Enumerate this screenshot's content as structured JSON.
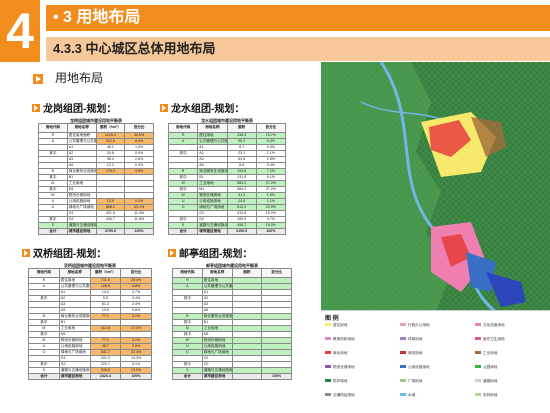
{
  "header": {
    "chapter_number": "4",
    "chapter_title": "• 3 用地布局",
    "section_title": "4.3.3 中心城区总体用地布局"
  },
  "subsection": {
    "title": "用地布局"
  },
  "groups": [
    {
      "key": "longgang",
      "title": "龙岗组团-规划：",
      "table_title": "龙岗组团城市建设用地平衡表",
      "headers": [
        "用地代码",
        "用地名称",
        "面积（hm²）",
        "百分比"
      ],
      "rows": [
        [
          "R",
          "居住用地面积",
          "1215.4",
          "30.5%",
          "hl"
        ],
        [
          "A",
          "公共管理与公共服务设施用地",
          "312.6",
          "8.4%",
          "hl"
        ],
        [
          "",
          "A1",
          "46.1",
          "1.0%",
          ""
        ],
        [
          "其中",
          "A2",
          "34.8",
          "0.9%",
          ""
        ],
        [
          "",
          "A3",
          "96.4",
          "2.6%",
          ""
        ],
        [
          "",
          "A5",
          "12.2",
          "0.4%",
          ""
        ],
        [
          "B",
          "商业服务业设施用地",
          "176.0",
          "4.8%",
          "hl"
        ],
        [
          "其中",
          "B1",
          "",
          "",
          ""
        ],
        [
          "M",
          "工业用地",
          "",
          "",
          ""
        ],
        [
          "其中",
          "M1",
          "",
          "",
          ""
        ],
        [
          "W",
          "物流仓储用地",
          "",
          "",
          ""
        ],
        [
          "U",
          "公用设施用地",
          "13.9",
          "0.4%",
          "hl"
        ],
        [
          "G",
          "绿地与广场用地",
          "858.2",
          "23.1%",
          "hl"
        ],
        [
          "",
          "G1",
          "421.5",
          "11.3%",
          ""
        ],
        [
          "其中",
          "G2",
          "436.7",
          "11.8%",
          ""
        ],
        [
          "S",
          "道路与交通设施用地",
          "",
          "",
          "g"
        ],
        [
          "合计",
          "城市建设用地",
          "3705.0",
          "100%",
          "t"
        ]
      ]
    },
    {
      "key": "longshui",
      "title": "龙水组团-规划：",
      "table_title": "龙水组团城市建设用地平衡表",
      "headers": [
        "用地代码",
        "用地名称",
        "面积",
        "百分比"
      ],
      "rows": [
        [
          "R",
          "居住用地",
          "338.4",
          "15.7%",
          "g"
        ],
        [
          "A",
          "公共管理与公共服务设施用地",
          "95.2",
          "4.4%",
          "g"
        ],
        [
          "",
          "A1",
          "8.7",
          "0.4%",
          ""
        ],
        [
          "其中",
          "A2",
          "23.1",
          "1.1%",
          ""
        ],
        [
          "",
          "A3",
          "54.6",
          "2.5%",
          ""
        ],
        [
          "",
          "A5",
          "8.8",
          "0.4%",
          ""
        ],
        [
          "B",
          "商业服务业设施用地",
          "154.8",
          "7.2%",
          "g"
        ],
        [
          "其中",
          "B1",
          "131.5",
          "6.1%",
          ""
        ],
        [
          "M",
          "工业用地",
          "584.2",
          "27.2%",
          "g"
        ],
        [
          "其中",
          "M1",
          "584.2",
          "27.2%",
          ""
        ],
        [
          "W",
          "物流仓储用地",
          "31.3",
          "1.5%",
          "g"
        ],
        [
          "U",
          "公用设施用地",
          "24.6",
          "1.1%",
          "g"
        ],
        [
          "G",
          "绿地与广场用地",
          "513.3",
          "23.9%",
          "g"
        ],
        [
          "",
          "G1",
          "412.8",
          "19.2%",
          ""
        ],
        [
          "其中",
          "G2",
          "100.5",
          "4.7%",
          ""
        ],
        [
          "S",
          "道路与交通设施用地",
          "408.7",
          "19.0%",
          "g"
        ],
        [
          "合计",
          "城市建设用地",
          "2150.5",
          "100%",
          "t"
        ]
      ]
    },
    {
      "key": "shuangqiao",
      "title": "双桥组团-规划：",
      "table_title": "双桥组团城市建设用地平衡表",
      "headers": [
        "用地代码",
        "用地名称",
        "面积（hm²）",
        "百分比"
      ],
      "rows": [
        [
          "R",
          "居住用地",
          "711.5",
          "29.4%",
          "hl"
        ],
        [
          "A",
          "公共管理与公共服务设施用地",
          "128.6",
          "4.8%",
          "hl"
        ],
        [
          "",
          "A1",
          "14.2",
          "0.7%",
          ""
        ],
        [
          "其中",
          "A2",
          "9.5",
          "0.4%",
          ""
        ],
        [
          "",
          "A3",
          "61.2",
          "2.4%",
          ""
        ],
        [
          "",
          "A5",
          "13.6",
          "0.6%",
          ""
        ],
        [
          "B",
          "商业服务业设施用地",
          "77.1",
          "3.2%",
          "hl"
        ],
        [
          "其中",
          "B1",
          "",
          "",
          ""
        ],
        [
          "M",
          "工业用地",
          "412.8",
          "17.0%",
          "hl"
        ],
        [
          "其中",
          "M1",
          "",
          "",
          ""
        ],
        [
          "W",
          "物流仓储用地",
          "77.2",
          "3.2%",
          "hl"
        ],
        [
          "U",
          "公用设施用地",
          "48.7",
          "2.0%",
          "hl"
        ],
        [
          "G",
          "绿地与广场用地",
          "541.7",
          "22.4%",
          "hl"
        ],
        [
          "",
          "G1",
          "321.0",
          "13.3%",
          ""
        ],
        [
          "其中",
          "G2",
          "220.7",
          "9.1%",
          ""
        ],
        [
          "S",
          "道路与交通设施用地",
          "336.8",
          "13.9%",
          "hl"
        ],
        [
          "合计",
          "城市建设用地",
          "2420.4",
          "100%",
          "t"
        ]
      ]
    },
    {
      "key": "youting",
      "title": "邮亭组团-规划：",
      "table_title": "邮亭组团城市建设用地平衡表",
      "headers": [
        "用地代码",
        "用地名称",
        "面积",
        "百分比"
      ],
      "rows": [
        [
          "R",
          "居住用地",
          "",
          "",
          "g"
        ],
        [
          "A",
          "公共管理与公共服务设施用地",
          "",
          "",
          "g"
        ],
        [
          "",
          "A1",
          "",
          "",
          ""
        ],
        [
          "其中",
          "A2",
          "",
          "",
          ""
        ],
        [
          "",
          "A3",
          "",
          "",
          ""
        ],
        [
          "",
          "A5",
          "",
          "",
          ""
        ],
        [
          "B",
          "商业服务业设施用地",
          "",
          "",
          "g"
        ],
        [
          "其中",
          "B1",
          "",
          "",
          ""
        ],
        [
          "M",
          "工业用地",
          "",
          "",
          "g"
        ],
        [
          "其中",
          "M1",
          "",
          "",
          ""
        ],
        [
          "W",
          "物流仓储用地",
          "",
          "",
          "g"
        ],
        [
          "U",
          "公用设施用地",
          "",
          "",
          "g"
        ],
        [
          "G",
          "绿地与广场用地",
          "",
          "",
          "g"
        ],
        [
          "",
          "G1",
          "",
          "",
          ""
        ],
        [
          "其中",
          "G2",
          "",
          "",
          ""
        ],
        [
          "S",
          "道路与交通设施用地",
          "",
          "",
          "g"
        ],
        [
          "合计",
          "城市建设用地",
          "",
          "100%",
          "t"
        ]
      ]
    }
  ],
  "legend": {
    "title": "图 例",
    "items": [
      {
        "label": "居住用地",
        "color": "#f6e96b"
      },
      {
        "label": "行政办公用地",
        "color": "#e8a0c8"
      },
      {
        "label": "文化设施用地",
        "color": "#ef7fb0"
      },
      {
        "label": "教育科研用地",
        "color": "#d68ec0"
      },
      {
        "label": "体育用地",
        "color": "#a07fc6"
      },
      {
        "label": "医疗卫生用地",
        "color": "#d45a8a"
      },
      {
        "label": "商业用地",
        "color": "#e84040"
      },
      {
        "label": "商务用地",
        "color": "#c83232"
      },
      {
        "label": "工业用地",
        "color": "#a36b3a"
      },
      {
        "label": "物流仓储用地",
        "color": "#8a5aa6"
      },
      {
        "label": "公用设施用地",
        "color": "#3a6fc6"
      },
      {
        "label": "公园绿地",
        "color": "#3bb34a"
      },
      {
        "label": "防护绿地",
        "color": "#2a8a3a"
      },
      {
        "label": "广场用地",
        "color": "#9ad08a"
      },
      {
        "label": "道路用地",
        "color": "#cfcfcf"
      },
      {
        "label": "交通场站用地",
        "color": "#8c8c8c"
      },
      {
        "label": "水域",
        "color": "#6fb8e8"
      },
      {
        "label": "农林用地",
        "color": "#b6d98e"
      }
    ]
  },
  "colors": {
    "accent": "#f28c1c",
    "accent_light": "#f6c89a",
    "map_base": "#3e8a46",
    "river": "#6fb8e8"
  }
}
